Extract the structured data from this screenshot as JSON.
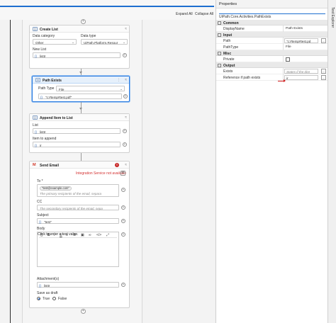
{
  "toolbar": {
    "expand_all": "Expand All",
    "collapse_all": "Collapse All"
  },
  "right_strip": {
    "label": "Test Explorer"
  },
  "properties": {
    "title": "Properties",
    "activity_type": "UiPath.Core.Activities.PathExists",
    "categories": [
      {
        "name": "Common",
        "rows": [
          {
            "name": "DisplayName",
            "value": "Path Exists"
          }
        ]
      },
      {
        "name": "Input",
        "rows": [
          {
            "name": "Path",
            "value": "\"c:#temp#test.pd"
          },
          {
            "name": "PathType",
            "value": "File"
          }
        ]
      },
      {
        "name": "Misc",
        "rows": [
          {
            "name": "Private",
            "value": ""
          }
        ]
      },
      {
        "name": "Output",
        "rows": [
          {
            "name": "Exists",
            "placeholder": "States if the dire"
          },
          {
            "name": "Reference if path exists",
            "value": "ir"
          }
        ]
      }
    ]
  },
  "cards": {
    "create_list": {
      "title": "Create List",
      "data_category_label": "Data category",
      "data_category_value": "Other",
      "data_type_label": "Data type",
      "data_type_value": "UiPath.Platform.Resour",
      "new_list_label": "New List",
      "new_list_value": "listtr"
    },
    "path_exists": {
      "title": "Path Exists",
      "path_type_label": "Path Type",
      "path_type_value": "File",
      "path_value": "\"c:#temp#test.pdf\""
    },
    "append_item": {
      "title": "Append Item to List",
      "list_label": "List",
      "list_value": "listtr",
      "item_label": "Item to append",
      "item_value": "ir"
    },
    "send_email": {
      "title": "Send Email",
      "warning": "Integration Service not available",
      "to_label": "To *",
      "to_chip": "\"test@example.com\"",
      "to_placeholder": "The primary recipients of the email, separa",
      "cc_label": "CC",
      "cc_placeholder": "The secondary recipients of the email, sepa",
      "subject_label": "Subject",
      "subject_value": "\"test\"",
      "body_label": "Body",
      "body_placeholder": "Click to enter a text value.",
      "attachments_label": "Attachment(s)",
      "attachments_value": "listtr",
      "save_draft_label": "Save as draft",
      "true_label": "True",
      "false_label": "False"
    }
  }
}
